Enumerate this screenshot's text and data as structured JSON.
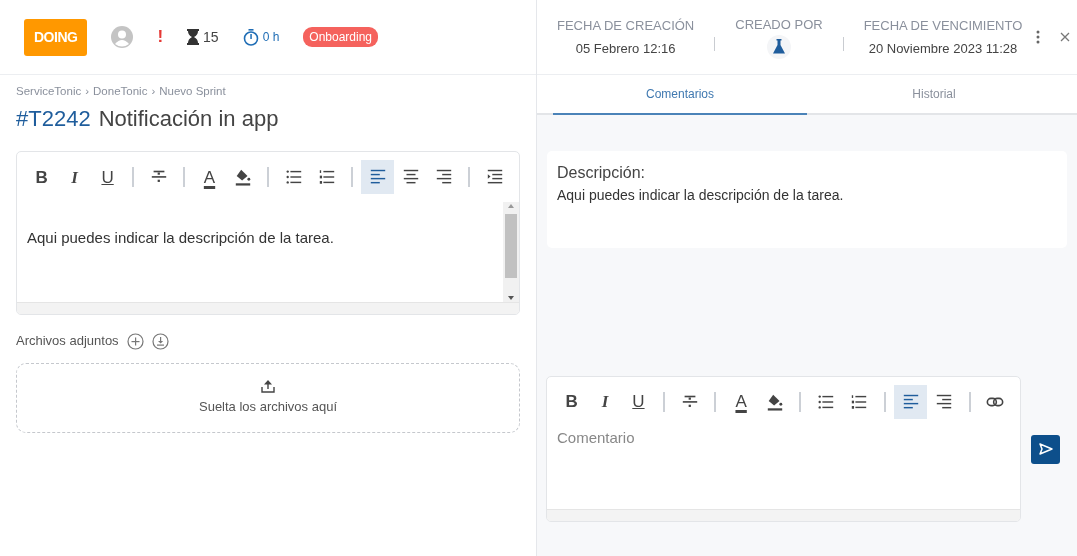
{
  "status": {
    "label": "DOING",
    "color": "#ff9800"
  },
  "priority": {
    "label": "!"
  },
  "estimate": {
    "value": "15"
  },
  "time_spent": {
    "value": "0 h"
  },
  "tag": {
    "label": "Onboarding",
    "color": "#f5625d"
  },
  "breadcrumb": {
    "separator": "›",
    "items": [
      "ServiceTonic",
      "DoneTonic",
      "Nuevo Sprint"
    ]
  },
  "task": {
    "id": "#T2242",
    "title": "Notificación in app"
  },
  "description_editor": {
    "toolbar": [
      {
        "kind": "bold",
        "label": "B",
        "selected": false
      },
      {
        "kind": "italic",
        "label": "I",
        "selected": false
      },
      {
        "kind": "underline",
        "label": "U",
        "selected": false
      },
      {
        "kind": "sep"
      },
      {
        "kind": "strike",
        "selected": false
      },
      {
        "kind": "sep"
      },
      {
        "kind": "text-color",
        "label": "A",
        "selected": false
      },
      {
        "kind": "fill",
        "selected": false
      },
      {
        "kind": "sep"
      },
      {
        "kind": "bullets",
        "selected": false
      },
      {
        "kind": "numbers",
        "selected": false
      },
      {
        "kind": "sep"
      },
      {
        "kind": "align-left",
        "selected": true
      },
      {
        "kind": "align-center",
        "selected": false
      },
      {
        "kind": "align-right",
        "selected": false
      },
      {
        "kind": "sep"
      },
      {
        "kind": "indent",
        "selected": false
      }
    ],
    "text": "Aqui puedes indicar la descripción de la tarea."
  },
  "attachments": {
    "label": "Archivos adjuntos",
    "dropzone": "Suelta los archivos aquí"
  },
  "meta": [
    {
      "kind": "text",
      "label": "FECHA DE CREACIÓN",
      "value": "05 Febrero 12:16"
    },
    {
      "kind": "avatar",
      "label": "CREADO POR"
    },
    {
      "kind": "text",
      "label": "FECHA DE VENCIMIENTO",
      "value": "20 Noviembre 2023 11:28"
    }
  ],
  "tabs": [
    {
      "label": "Comentarios",
      "selected": true
    },
    {
      "label": "Historial",
      "selected": false
    }
  ],
  "description_card": {
    "title": "Descripción:",
    "text": "Aqui puedes indicar la descripción de la tarea."
  },
  "comment_editor": {
    "toolbar": [
      {
        "kind": "bold",
        "label": "B",
        "selected": false
      },
      {
        "kind": "italic",
        "label": "I",
        "selected": false
      },
      {
        "kind": "underline",
        "label": "U",
        "selected": false
      },
      {
        "kind": "sep"
      },
      {
        "kind": "strike",
        "selected": false
      },
      {
        "kind": "sep"
      },
      {
        "kind": "text-color",
        "label": "A",
        "selected": false
      },
      {
        "kind": "fill",
        "selected": false
      },
      {
        "kind": "sep"
      },
      {
        "kind": "bullets",
        "selected": false
      },
      {
        "kind": "numbers",
        "selected": false
      },
      {
        "kind": "sep"
      },
      {
        "kind": "align-left",
        "selected": true
      },
      {
        "kind": "align-right",
        "selected": false
      },
      {
        "kind": "sep"
      },
      {
        "kind": "link",
        "selected": false
      }
    ],
    "placeholder": "Comentario"
  }
}
